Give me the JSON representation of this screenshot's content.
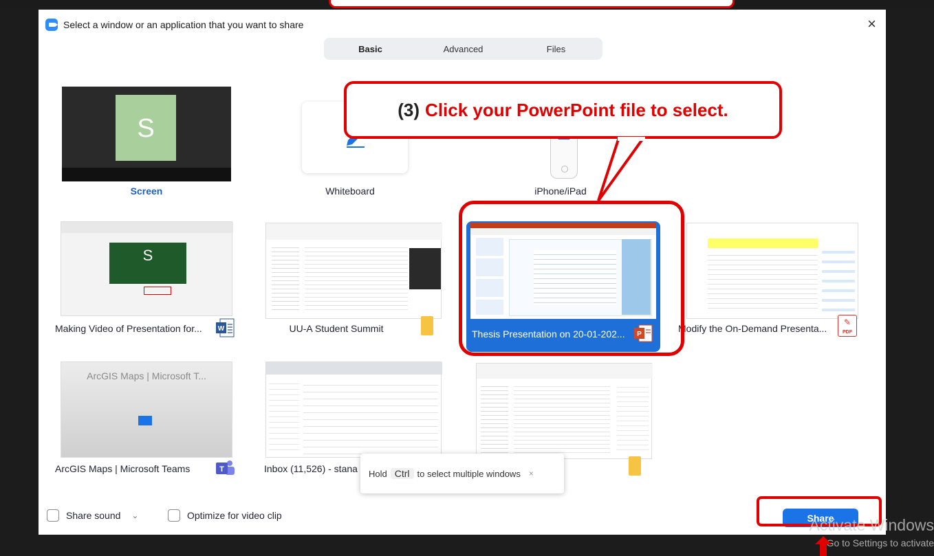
{
  "dialog": {
    "title": "Select a window or an application that you want to share",
    "close_glyph": "×"
  },
  "tabs": [
    {
      "label": "Basic",
      "active": true
    },
    {
      "label": "Advanced",
      "active": false
    },
    {
      "label": "Files",
      "active": false
    }
  ],
  "tiles": {
    "screen": {
      "label": "Screen",
      "avatar_letter": "S"
    },
    "whiteboard": {
      "label": "Whiteboard"
    },
    "iphone": {
      "label": "iPhone/iPad"
    },
    "making_video": {
      "label": "Making Video of Presentation for...",
      "app": "word",
      "thumb_letter": "S"
    },
    "summit": {
      "label": "UU-A Student Summit",
      "app": "folder"
    },
    "thesis": {
      "label": "Thesis Presentation on 20-01-202...",
      "app": "powerpoint",
      "selected": true
    },
    "modify": {
      "label": "Modify the On-Demand Presenta...",
      "app": "pdf",
      "badge_text": "PDF"
    },
    "arcgis": {
      "label": "ArcGIS Maps | Microsoft Teams",
      "app": "teams",
      "thumb_title": "ArcGIS Maps | Microsoft T..."
    },
    "inbox": {
      "label": "Inbox (11,526) - stana",
      "app": "chrome"
    },
    "explorer": {
      "label": "",
      "app": "folder"
    }
  },
  "callout": {
    "step": "(3)",
    "text": "Click your PowerPoint file to select."
  },
  "tooltip": {
    "before": "Hold",
    "key": "Ctrl",
    "after": "to select multiple windows",
    "close_glyph": "×"
  },
  "options": {
    "share_sound": "Share sound",
    "share_sound_chevron": "⌄",
    "optimize_video": "Optimize for video clip"
  },
  "share_button": "Share",
  "watermark": {
    "line1": "Activate Windows",
    "line2": "Go to Settings to activate"
  },
  "colors": {
    "accent_blue": "#1a74e8",
    "selected_tile": "#1f6fd8",
    "annotation_red": "#e00000"
  }
}
